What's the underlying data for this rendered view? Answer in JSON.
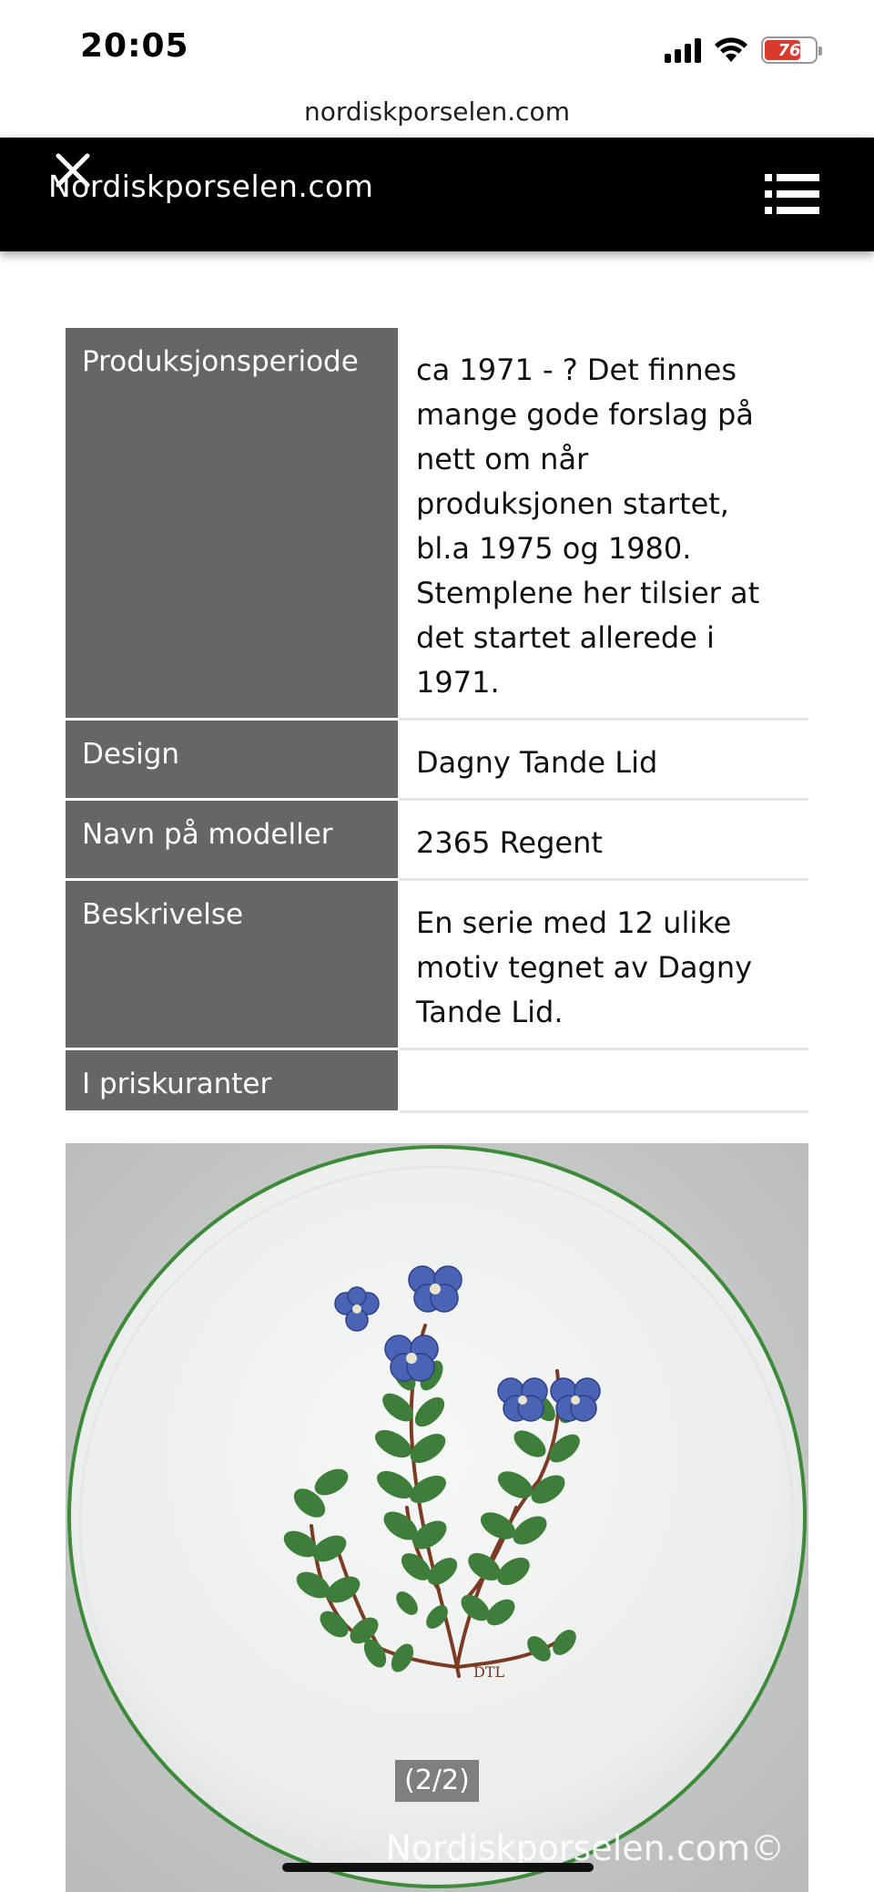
{
  "status_bar": {
    "time": "20:05",
    "battery_level": "76",
    "icons": [
      "signal-icon",
      "wifi-icon",
      "battery-icon"
    ]
  },
  "browser": {
    "url": "nordiskporselen.com"
  },
  "header": {
    "site_title": "Nordiskporselen.com",
    "icons": [
      "close-icon",
      "menu-icon"
    ]
  },
  "info_table": [
    {
      "label": "Produksjonsperiode",
      "value": "ca 1971 - ? Det finnes mange gode forslag på nett om når produksjonen startet, bl.a 1975 og 1980. Stemplene her tilsier at det startet allerede i 1971."
    },
    {
      "label": "Design",
      "value": "Dagny Tande Lid"
    },
    {
      "label": "Navn på modeller",
      "value": "2365 Regent"
    },
    {
      "label": "Beskrivelse",
      "value": "En serie med 12 ulike motiv tegnet av Dagny Tande Lid."
    },
    {
      "label": "I priskuranter",
      "value": ""
    }
  ],
  "gallery": {
    "counter": "(2/2)",
    "watermark": "Nordiskporselen.com©",
    "signature": "DTL"
  },
  "colors": {
    "header_bg": "#000000",
    "label_bg": "#666666",
    "plate_rim": "#3c8a3a",
    "flower_blue": "#4b63b5",
    "leaf_green": "#3e7d3a",
    "stem_brown": "#7a3b22"
  }
}
